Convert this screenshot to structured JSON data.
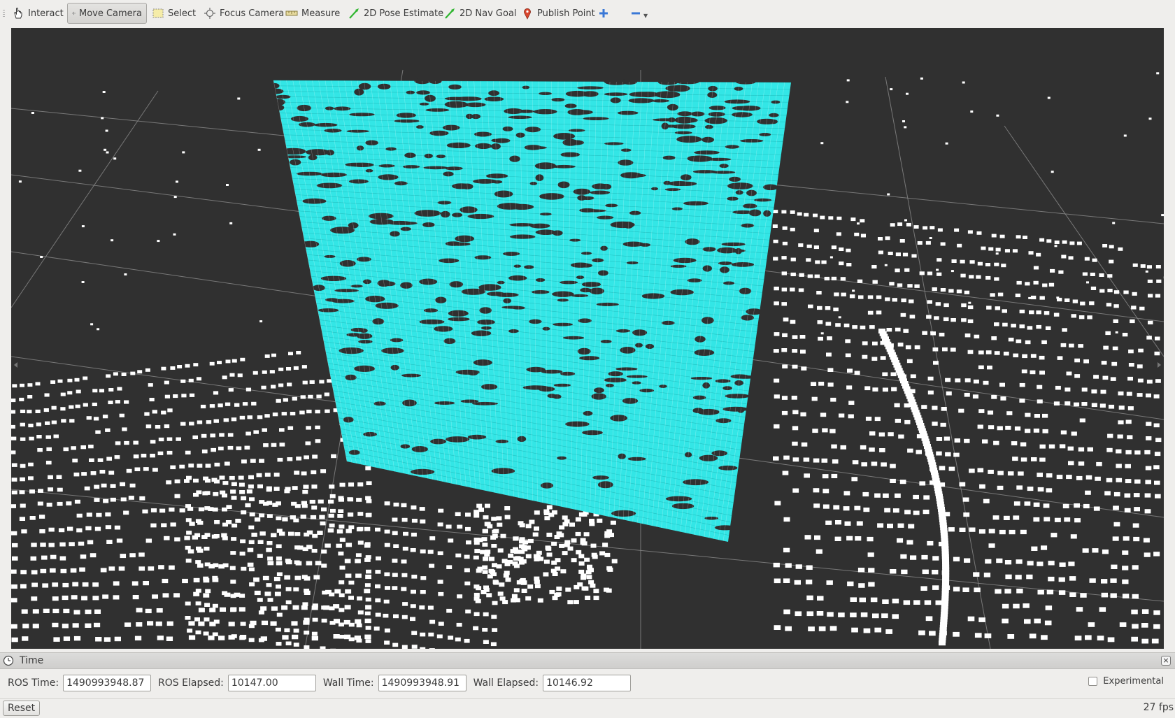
{
  "toolbar": {
    "tools": [
      {
        "label": "Interact",
        "icon": "hand-icon"
      },
      {
        "label": "Move Camera",
        "icon": "move-camera-icon",
        "active": true
      },
      {
        "label": "Select",
        "icon": "select-icon"
      },
      {
        "label": "Focus Camera",
        "icon": "focus-camera-icon"
      },
      {
        "label": "Measure",
        "icon": "ruler-icon"
      },
      {
        "label": "2D Pose Estimate",
        "icon": "green-arrow-icon"
      },
      {
        "label": "2D Nav Goal",
        "icon": "green-arrow-icon"
      },
      {
        "label": "Publish Point",
        "icon": "map-pin-icon"
      }
    ]
  },
  "colors": {
    "background": "#303030",
    "grid": "#8a8a8a",
    "cloud_white": "#ffffff",
    "cloud_cyan": "#33e6e6",
    "cyan_outline": "#1ab3b3"
  },
  "time_panel": {
    "title": "Time",
    "ros_time_label": "ROS Time:",
    "ros_time": "1490993948.87",
    "ros_elapsed_label": "ROS Elapsed:",
    "ros_elapsed": "10147.00",
    "wall_time_label": "Wall Time:",
    "wall_time": "1490993948.91",
    "wall_elapsed_label": "Wall Elapsed:",
    "wall_elapsed": "10146.92",
    "experimental_label": "Experimental",
    "experimental_checked": false
  },
  "status": {
    "reset_label": "Reset",
    "fps": "27 fps"
  }
}
